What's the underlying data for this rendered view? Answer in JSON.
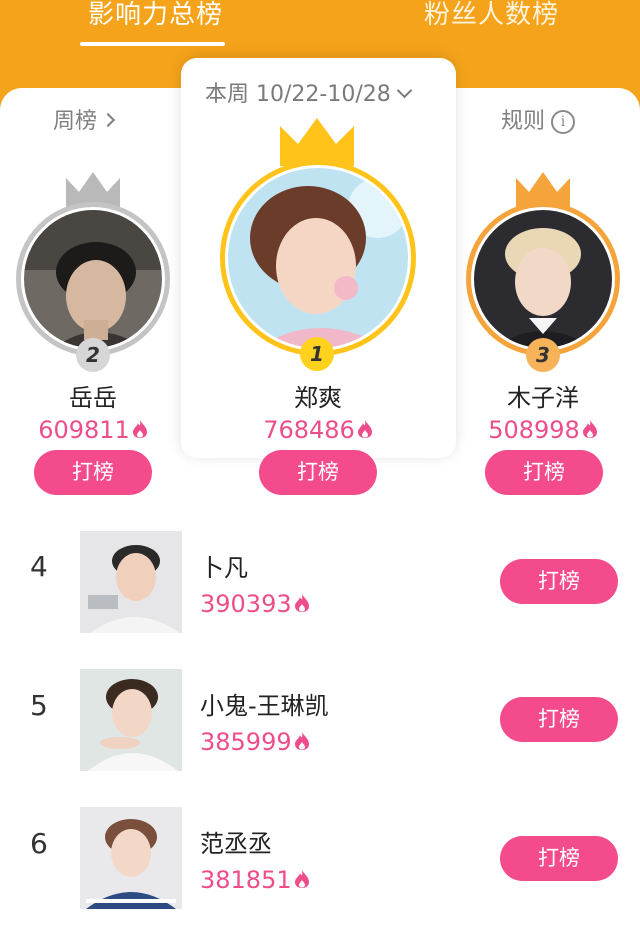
{
  "tabs": [
    {
      "label": "影响力总榜",
      "active": true
    },
    {
      "label": "粉丝人数榜",
      "active": false
    }
  ],
  "period": {
    "label": "本周 10/22-10/28"
  },
  "weekly_link": {
    "label": "周榜"
  },
  "rules_link": {
    "label": "规则"
  },
  "top_three": [
    {
      "rank": "2",
      "name": "岳岳",
      "score": "609811",
      "button": "打榜",
      "crown_color": "#b9b9b9",
      "badge_color": "#d6d6d6"
    },
    {
      "rank": "1",
      "name": "郑爽",
      "score": "768486",
      "button": "打榜",
      "crown_color": "#ffc31a",
      "badge_color": "#ffd21e"
    },
    {
      "rank": "3",
      "name": "木子洋",
      "score": "508998",
      "button": "打榜",
      "crown_color": "#f4a43a",
      "badge_color": "#f7b35a"
    }
  ],
  "list": [
    {
      "rank": "4",
      "name": "卜凡",
      "score": "390393",
      "button": "打榜"
    },
    {
      "rank": "5",
      "name": "小鬼-王琳凯",
      "score": "385999",
      "button": "打榜"
    },
    {
      "rank": "6",
      "name": "范丞丞",
      "score": "381851",
      "button": "打榜"
    }
  ],
  "colors": {
    "accent": "#f5a31a",
    "button": "#f44b8d",
    "score": "#ee4d8c"
  }
}
